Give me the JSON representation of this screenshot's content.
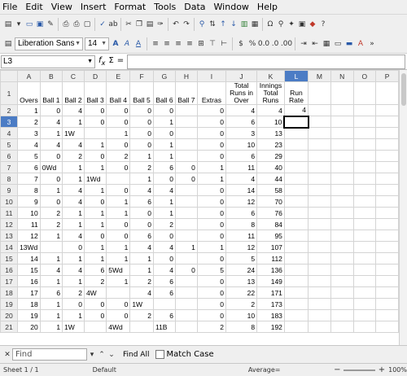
{
  "menu": [
    "File",
    "Edit",
    "View",
    "Insert",
    "Format",
    "Tools",
    "Data",
    "Window",
    "Help"
  ],
  "toolbar2": {
    "font_name": "Liberation Sans",
    "font_size": "14"
  },
  "formula": {
    "cell_ref": "L3",
    "sum_symbol": "Σ",
    "equals_symbol": "="
  },
  "grid": {
    "columns": [
      "A",
      "B",
      "C",
      "D",
      "E",
      "F",
      "G",
      "H",
      "I",
      "J",
      "K",
      "L",
      "M",
      "N",
      "O",
      "P"
    ],
    "selected_column": "L",
    "header_row": {
      "num": "1",
      "cells": [
        "Overs",
        "Ball 1",
        "Ball 2",
        "Ball 3",
        "Ball 4",
        "Ball 5",
        "Ball 6",
        "Ball 7",
        "Extras",
        "Total Runs in Over",
        "Innings Total Runs",
        "Run Rate",
        "",
        "",
        "",
        ""
      ]
    },
    "rows": [
      {
        "num": "2",
        "cells": [
          "1",
          "0",
          "4",
          "0",
          "0",
          "0",
          "0",
          "",
          "0",
          "4",
          "4",
          "4",
          "",
          "",
          "",
          ""
        ]
      },
      {
        "num": "3",
        "cells": [
          "2",
          "4",
          "1",
          "0",
          "0",
          "0",
          "1",
          "",
          "0",
          "6",
          "10",
          "",
          "",
          "",
          "",
          ""
        ]
      },
      {
        "num": "4",
        "cells": [
          "3",
          "1",
          "1W",
          "",
          "1",
          "0",
          "0",
          "",
          "0",
          "3",
          "13",
          "",
          "",
          "",
          "",
          ""
        ]
      },
      {
        "num": "5",
        "cells": [
          "4",
          "4",
          "4",
          "1",
          "0",
          "0",
          "1",
          "",
          "0",
          "10",
          "23",
          "",
          "",
          "",
          "",
          ""
        ]
      },
      {
        "num": "6",
        "cells": [
          "5",
          "0",
          "2",
          "0",
          "2",
          "1",
          "1",
          "",
          "0",
          "6",
          "29",
          "",
          "",
          "",
          "",
          ""
        ]
      },
      {
        "num": "7",
        "cells": [
          "6",
          "0Wd",
          "1",
          "1",
          "0",
          "2",
          "6",
          "0",
          "1",
          "11",
          "40",
          "",
          "",
          "",
          "",
          ""
        ]
      },
      {
        "num": "8",
        "cells": [
          "7",
          "0",
          "1",
          "1Wd",
          "",
          "1",
          "0",
          "0",
          "1",
          "4",
          "44",
          "",
          "",
          "",
          "",
          ""
        ]
      },
      {
        "num": "9",
        "cells": [
          "8",
          "1",
          "4",
          "1",
          "0",
          "4",
          "4",
          "",
          "0",
          "14",
          "58",
          "",
          "",
          "",
          "",
          ""
        ]
      },
      {
        "num": "10",
        "cells": [
          "9",
          "0",
          "4",
          "0",
          "1",
          "6",
          "1",
          "",
          "0",
          "12",
          "70",
          "",
          "",
          "",
          "",
          ""
        ]
      },
      {
        "num": "11",
        "cells": [
          "10",
          "2",
          "1",
          "1",
          "1",
          "0",
          "1",
          "",
          "0",
          "6",
          "76",
          "",
          "",
          "",
          "",
          ""
        ]
      },
      {
        "num": "12",
        "cells": [
          "11",
          "2",
          "1",
          "1",
          "0",
          "0",
          "2",
          "",
          "0",
          "8",
          "84",
          "",
          "",
          "",
          "",
          ""
        ]
      },
      {
        "num": "13",
        "cells": [
          "12",
          "1",
          "4",
          "0",
          "0",
          "6",
          "0",
          "",
          "0",
          "11",
          "95",
          "",
          "",
          "",
          "",
          ""
        ]
      },
      {
        "num": "14",
        "cells": [
          "13Wd",
          "",
          "0",
          "1",
          "1",
          "4",
          "4",
          "1",
          "1",
          "12",
          "107",
          "",
          "",
          "",
          "",
          ""
        ]
      },
      {
        "num": "15",
        "cells": [
          "14",
          "1",
          "1",
          "1",
          "1",
          "1",
          "0",
          "",
          "0",
          "5",
          "112",
          "",
          "",
          "",
          "",
          ""
        ]
      },
      {
        "num": "16",
        "cells": [
          "15",
          "4",
          "4",
          "6",
          "5Wd",
          "1",
          "4",
          "0",
          "5",
          "24",
          "136",
          "",
          "",
          "",
          "",
          ""
        ]
      },
      {
        "num": "17",
        "cells": [
          "16",
          "1",
          "1",
          "2",
          "1",
          "2",
          "6",
          "",
          "0",
          "13",
          "149",
          "",
          "",
          "",
          "",
          ""
        ]
      },
      {
        "num": "18",
        "cells": [
          "17",
          "6",
          "2",
          "4W",
          "",
          "4",
          "6",
          "",
          "0",
          "22",
          "171",
          "",
          "",
          "",
          "",
          ""
        ]
      },
      {
        "num": "19",
        "cells": [
          "18",
          "1",
          "0",
          "0",
          "0",
          "1W",
          "",
          "",
          "0",
          "2",
          "173",
          "",
          "",
          "",
          "",
          ""
        ]
      },
      {
        "num": "20",
        "cells": [
          "19",
          "1",
          "1",
          "0",
          "0",
          "2",
          "6",
          "",
          "0",
          "10",
          "183",
          "",
          "",
          "",
          "",
          ""
        ]
      },
      {
        "num": "21",
        "cells": [
          "20",
          "1",
          "1W",
          "",
          "4Wd",
          "",
          "11B",
          "",
          "2",
          "8",
          "192",
          "",
          "",
          "",
          "",
          ""
        ]
      }
    ]
  },
  "findbar": {
    "placeholder": "Find",
    "find_all": "Find All",
    "match_case": "Match Case"
  },
  "status": {
    "sheet": "Sheet 1 / 1",
    "style": "Default",
    "average": "Average=",
    "zoom": "100%"
  }
}
